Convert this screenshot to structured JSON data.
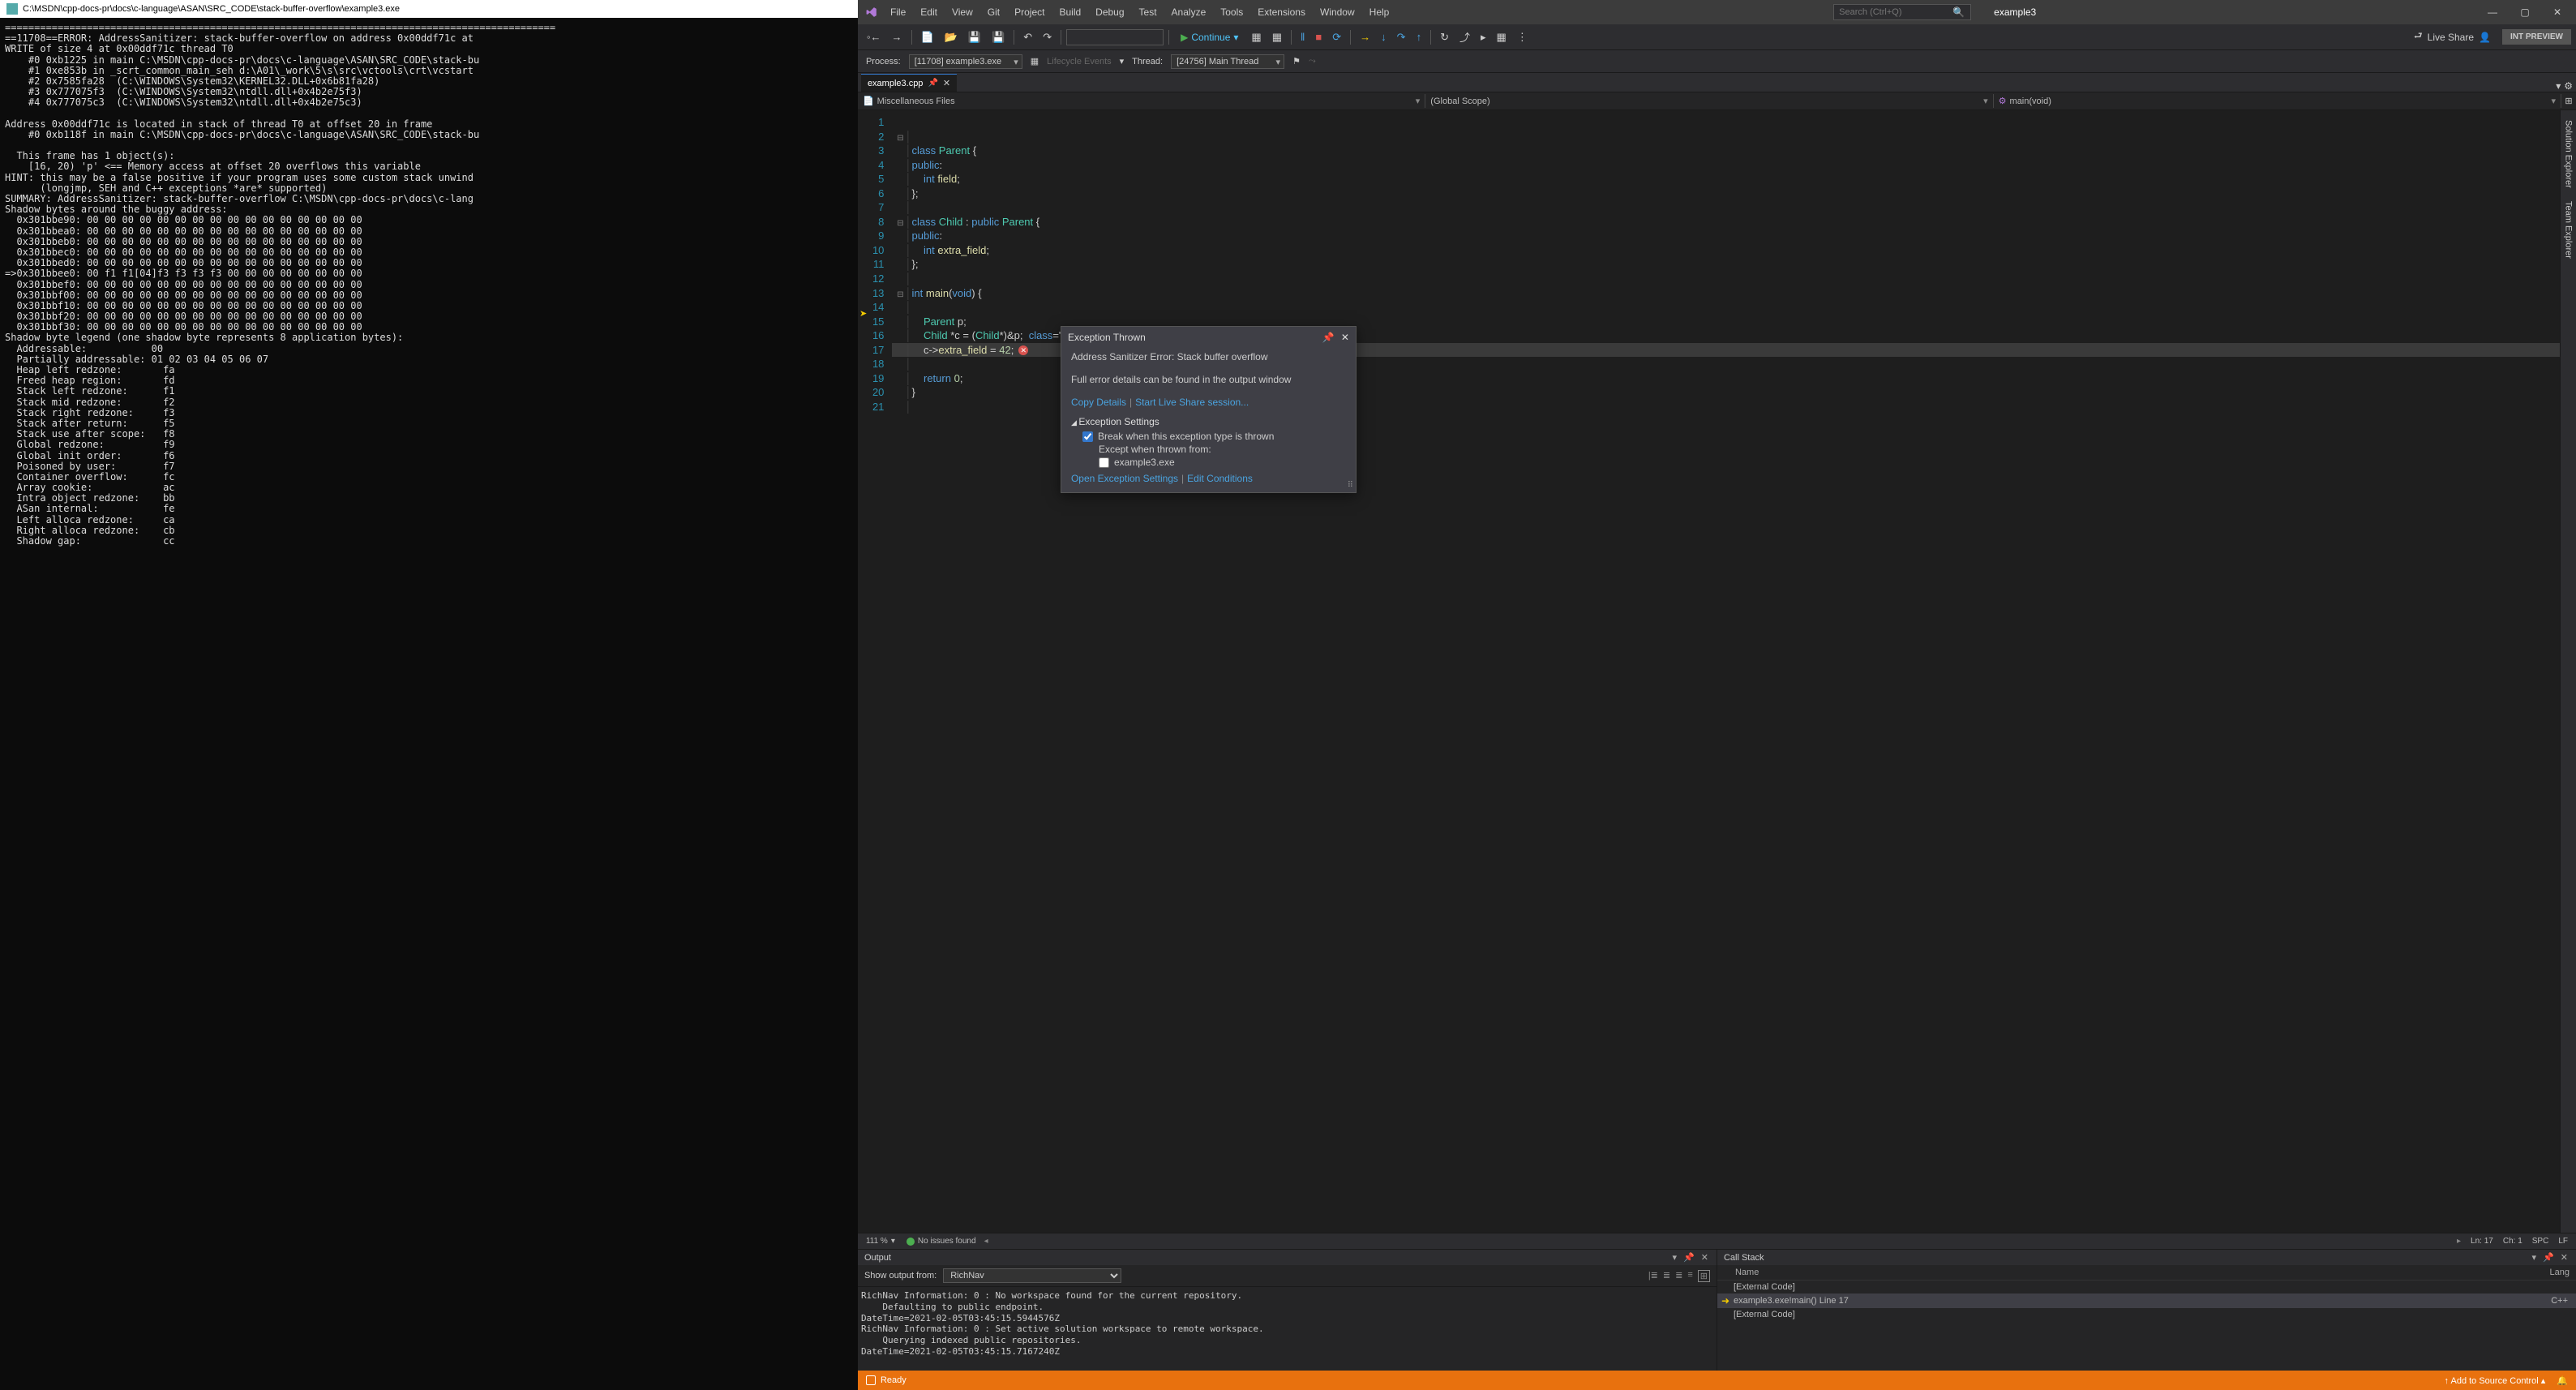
{
  "console": {
    "title": "C:\\MSDN\\cpp-docs-pr\\docs\\c-language\\ASAN\\SRC_CODE\\stack-buffer-overflow\\example3.exe",
    "body": "==============================================================================================\n==11708==ERROR: AddressSanitizer: stack-buffer-overflow on address 0x00ddf71c at\nWRITE of size 4 at 0x00ddf71c thread T0\n    #0 0xb1225 in main C:\\MSDN\\cpp-docs-pr\\docs\\c-language\\ASAN\\SRC_CODE\\stack-bu\n    #1 0xe853b in _scrt_common_main_seh d:\\A01\\_work\\5\\s\\src\\vctools\\crt\\vcstart\n    #2 0x7585fa28  (C:\\WINDOWS\\System32\\KERNEL32.DLL+0x6b81fa28)\n    #3 0x777075f3  (C:\\WINDOWS\\System32\\ntdll.dll+0x4b2e75f3)\n    #4 0x777075c3  (C:\\WINDOWS\\System32\\ntdll.dll+0x4b2e75c3)\n\nAddress 0x00ddf71c is located in stack of thread T0 at offset 20 in frame\n    #0 0xb118f in main C:\\MSDN\\cpp-docs-pr\\docs\\c-language\\ASAN\\SRC_CODE\\stack-bu\n\n  This frame has 1 object(s):\n    [16, 20) 'p' <== Memory access at offset 20 overflows this variable\nHINT: this may be a false positive if your program uses some custom stack unwind\n      (longjmp, SEH and C++ exceptions *are* supported)\nSUMMARY: AddressSanitizer: stack-buffer-overflow C:\\MSDN\\cpp-docs-pr\\docs\\c-lang\nShadow bytes around the buggy address:\n  0x301bbe90: 00 00 00 00 00 00 00 00 00 00 00 00 00 00 00 00\n  0x301bbea0: 00 00 00 00 00 00 00 00 00 00 00 00 00 00 00 00\n  0x301bbeb0: 00 00 00 00 00 00 00 00 00 00 00 00 00 00 00 00\n  0x301bbec0: 00 00 00 00 00 00 00 00 00 00 00 00 00 00 00 00\n  0x301bbed0: 00 00 00 00 00 00 00 00 00 00 00 00 00 00 00 00\n=>0x301bbee0: 00 f1 f1[04]f3 f3 f3 f3 00 00 00 00 00 00 00 00\n  0x301bbef0: 00 00 00 00 00 00 00 00 00 00 00 00 00 00 00 00\n  0x301bbf00: 00 00 00 00 00 00 00 00 00 00 00 00 00 00 00 00\n  0x301bbf10: 00 00 00 00 00 00 00 00 00 00 00 00 00 00 00 00\n  0x301bbf20: 00 00 00 00 00 00 00 00 00 00 00 00 00 00 00 00\n  0x301bbf30: 00 00 00 00 00 00 00 00 00 00 00 00 00 00 00 00\nShadow byte legend (one shadow byte represents 8 application bytes):\n  Addressable:           00\n  Partially addressable: 01 02 03 04 05 06 07\n  Heap left redzone:       fa\n  Freed heap region:       fd\n  Stack left redzone:      f1\n  Stack mid redzone:       f2\n  Stack right redzone:     f3\n  Stack after return:      f5\n  Stack use after scope:   f8\n  Global redzone:          f9\n  Global init order:       f6\n  Poisoned by user:        f7\n  Container overflow:      fc\n  Array cookie:            ac\n  Intra object redzone:    bb\n  ASan internal:           fe\n  Left alloca redzone:     ca\n  Right alloca redzone:    cb\n  Shadow gap:              cc"
  },
  "vs": {
    "menus": [
      "File",
      "Edit",
      "View",
      "Git",
      "Project",
      "Build",
      "Debug",
      "Test",
      "Analyze",
      "Tools",
      "Extensions",
      "Window",
      "Help"
    ],
    "search_placeholder": "Search (Ctrl+Q)",
    "project": "example3",
    "continue_label": "Continue",
    "live_share": "Live Share",
    "int_preview": "INT PREVIEW",
    "debugbar": {
      "process_label": "Process:",
      "process": "[11708] example3.exe",
      "lifecycle": "Lifecycle Events",
      "thread_label": "Thread:",
      "thread": "[24756] Main Thread"
    },
    "tab_name": "example3.cpp",
    "scope": {
      "left": "Miscellaneous Files",
      "mid": "(Global Scope)",
      "right": "main(void)",
      "right_icon": "⚙"
    },
    "code": {
      "lines": [
        "",
        "class Parent {",
        "public:",
        "    int field;",
        "};",
        "",
        "class Child : public Parent {",
        "public:",
        "    int extra_field;",
        "};",
        "",
        "int main(void) {",
        "",
        "    Parent p;",
        "    Child *c = (Child*)&p;  // Boom !",
        "    c->extra_field = 42;",
        "",
        "    return 0;",
        "}",
        ""
      ],
      "current_line": 17
    },
    "exception": {
      "title": "Exception Thrown",
      "msg1": "Address Sanitizer Error: Stack buffer overflow",
      "msg2": "Full error details can be found in the output window",
      "copy_details": "Copy Details",
      "start_live": "Start Live Share session...",
      "es_title": "Exception Settings",
      "break_label": "Break when this exception type is thrown",
      "except_label": "Except when thrown from:",
      "except_item": "example3.exe",
      "open_settings": "Open Exception Settings",
      "edit_cond": "Edit Conditions"
    },
    "zoombar": {
      "zoom": "111 %",
      "noissues": "No issues found",
      "ln": "Ln: 17",
      "ch": "Ch: 1",
      "spc": "SPC",
      "lf": "LF"
    },
    "output": {
      "title": "Output",
      "show_from": "Show output from:",
      "source": "RichNav",
      "text": "RichNav Information: 0 : No workspace found for the current repository.\n    Defaulting to public endpoint.\nDateTime=2021-02-05T03:45:15.5944576Z\nRichNav Information: 0 : Set active solution workspace to remote workspace.\n    Querying indexed public repositories.\nDateTime=2021-02-05T03:45:15.7167240Z"
    },
    "callstack": {
      "title": "Call Stack",
      "col_name": "Name",
      "col_lang": "Lang",
      "rows": [
        {
          "name": "[External Code]",
          "lang": "",
          "current": false
        },
        {
          "name": "example3.exe!main() Line 17",
          "lang": "C++",
          "current": true
        },
        {
          "name": "[External Code]",
          "lang": "",
          "current": false
        }
      ]
    },
    "sideTabs": [
      "Solution Explorer",
      "Team Explorer"
    ],
    "status": {
      "ready": "Ready",
      "add_src": "Add to Source Control"
    }
  }
}
